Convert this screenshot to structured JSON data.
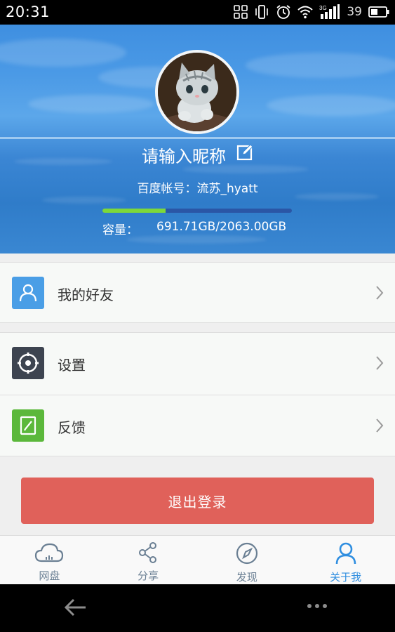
{
  "status_bar": {
    "time": "20:31",
    "battery_level": "39",
    "network_type": "3G",
    "icons": [
      "screen-share-icon",
      "vibrate-icon",
      "alarm-icon",
      "wifi-icon",
      "signal-icon",
      "battery-icon"
    ]
  },
  "profile": {
    "nickname": "请输入昵称",
    "account_label": "百度帐号：流苏_hyatt",
    "capacity_label": "容量：",
    "capacity_value": "691.71GB/2063.00GB",
    "storage_used_fraction": 0.335,
    "storage_fill_color": "#7dd83a",
    "storage_track_color": "#2a56a6"
  },
  "menu": {
    "friends": {
      "label": "我的好友",
      "icon": "user-icon",
      "color": "#4a9ee6"
    },
    "settings": {
      "label": "设置",
      "icon": "gear-icon",
      "color": "#3d4450"
    },
    "feedback": {
      "label": "反馈",
      "icon": "feedback-icon",
      "color": "#5bb83b"
    }
  },
  "logout": {
    "label": "退出登录",
    "color": "#e0615a"
  },
  "tabs": [
    {
      "label": "网盘",
      "icon": "cloud-icon"
    },
    {
      "label": "分享",
      "icon": "share-icon"
    },
    {
      "label": "发现",
      "icon": "compass-icon"
    },
    {
      "label": "关于我",
      "icon": "person-icon",
      "active": true
    }
  ],
  "colors": {
    "accent": "#2f8ee0",
    "tab_inactive": "#6a7f93"
  }
}
